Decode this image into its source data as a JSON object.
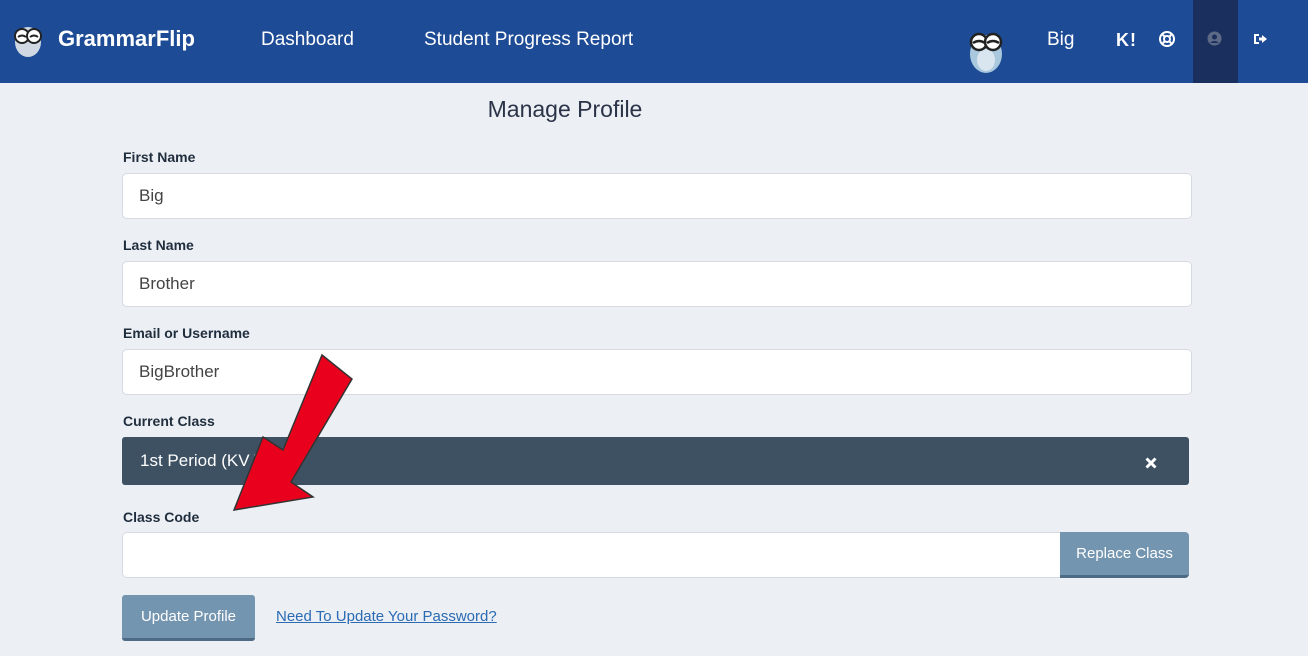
{
  "header": {
    "brand": "GrammarFlip",
    "nav": {
      "dashboard": "Dashboard",
      "progress_report": "Student Progress Report"
    },
    "user_name": "Big",
    "kahoot_label": "K!",
    "icons": [
      "owl-logo-icon",
      "owl-avatar-icon",
      "help-icon",
      "profile-icon",
      "logout-icon"
    ]
  },
  "page": {
    "title": "Manage Profile"
  },
  "form": {
    "first_name": {
      "label": "First Name",
      "value": "Big"
    },
    "last_name": {
      "label": "Last Name",
      "value": "Brother"
    },
    "username": {
      "label": "Email or Username",
      "value": "BigBrother"
    },
    "current_class": {
      "label": "Current Class",
      "value": "1st Period (KV      W2I)"
    },
    "class_code": {
      "label": "Class Code",
      "value": "",
      "button": "Replace Class"
    },
    "update_button": "Update Profile",
    "password_link": "Need To Update Your Password?"
  },
  "colors": {
    "header_bg": "#1e4b95",
    "button_bg": "#7495b0",
    "class_bar_bg": "#3d5163",
    "annotation_arrow": "#e8001c"
  }
}
